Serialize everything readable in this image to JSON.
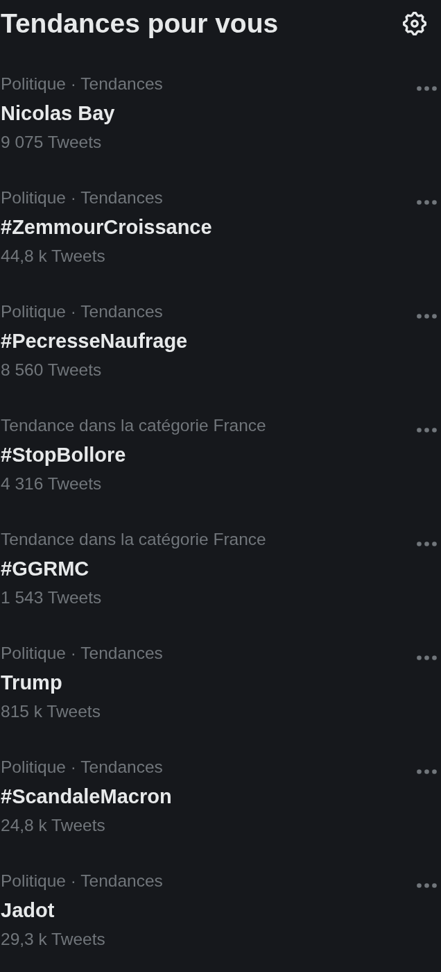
{
  "header": {
    "title": "Tendances pour vous"
  },
  "trends": [
    {
      "context": "Politique · Tendances",
      "name": "Nicolas Bay",
      "count": "9 075 Tweets"
    },
    {
      "context": "Politique · Tendances",
      "name": "#ZemmourCroissance",
      "count": "44,8 k Tweets"
    },
    {
      "context": "Politique · Tendances",
      "name": "#PecresseNaufrage",
      "count": "8 560 Tweets"
    },
    {
      "context": "Tendance dans la catégorie France",
      "name": "#StopBollore",
      "count": "4 316 Tweets"
    },
    {
      "context": "Tendance dans la catégorie France",
      "name": "#GGRMC",
      "count": "1 543 Tweets"
    },
    {
      "context": "Politique · Tendances",
      "name": "Trump",
      "count": "815 k Tweets"
    },
    {
      "context": "Politique · Tendances",
      "name": "#ScandaleMacron",
      "count": "24,8 k Tweets"
    },
    {
      "context": "Politique · Tendances",
      "name": "Jadot",
      "count": "29,3 k Tweets"
    }
  ]
}
